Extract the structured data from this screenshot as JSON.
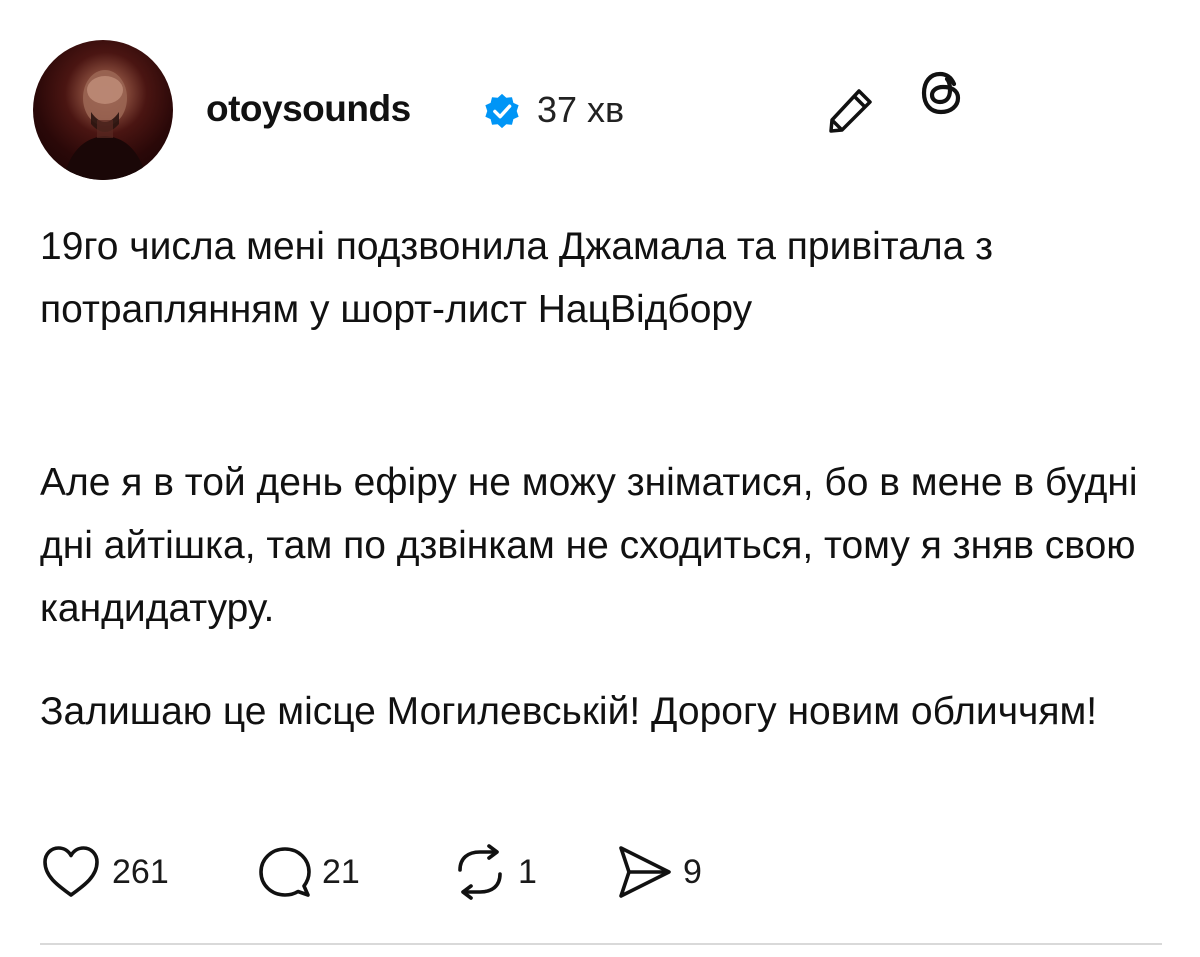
{
  "post": {
    "username": "otoysounds",
    "time_ago": "37 хв",
    "paragraphs": [
      "19го числа мені подзвонила Джамала та привітала з потраплянням у шорт-лист НацВідбору",
      "Але я в той день ефіру не можу зніматися, бо в мене в будні дні айтішка, там по дзвінкам не сходиться, тому я зняв свою кандидатуру.",
      "Залишаю це місце Могилевській! Дорогу новим обличчям!"
    ],
    "stats": {
      "likes": "261",
      "replies": "21",
      "reposts": "1",
      "shares": "9"
    }
  },
  "icons": {
    "verified": "verified-badge-icon",
    "edit": "pencil-edit-icon",
    "app": "threads-logo-icon",
    "like": "heart-icon",
    "reply": "speech-bubble-icon",
    "repost": "repost-arrows-icon",
    "share": "send-arrow-icon"
  },
  "colors": {
    "verified_badge": "#0095F6",
    "text": "#111111",
    "divider": "#D9D9D9",
    "background": "#FFFFFF"
  }
}
